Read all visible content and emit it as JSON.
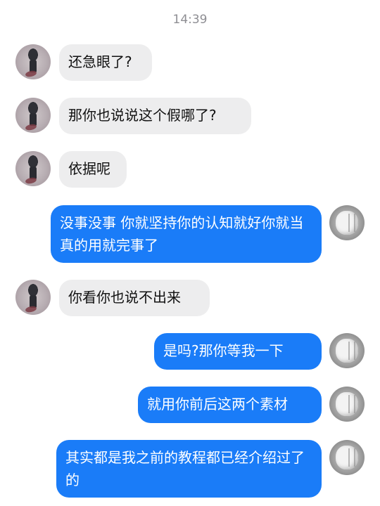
{
  "chat": {
    "timestamp": "14:39",
    "colors": {
      "incoming_bubble": "#ededee",
      "outgoing_bubble": "#1a7cf8",
      "timestamp_text": "#8e8e93"
    },
    "messages": [
      {
        "from": "other",
        "text": "还急眼了?"
      },
      {
        "from": "other",
        "text": "那你也说说这个假哪了?"
      },
      {
        "from": "other",
        "text": "依据呢"
      },
      {
        "from": "me",
        "text": "没事没事 你就坚持你的认知就好你就当真的用就完事了"
      },
      {
        "from": "other",
        "text": "你看你也说不出来"
      },
      {
        "from": "me",
        "text": "是吗?那你等我一下"
      },
      {
        "from": "me",
        "text": "就用你前后这两个素材"
      },
      {
        "from": "me",
        "text": "其实都是我之前的教程都已经介绍过了的"
      }
    ]
  }
}
